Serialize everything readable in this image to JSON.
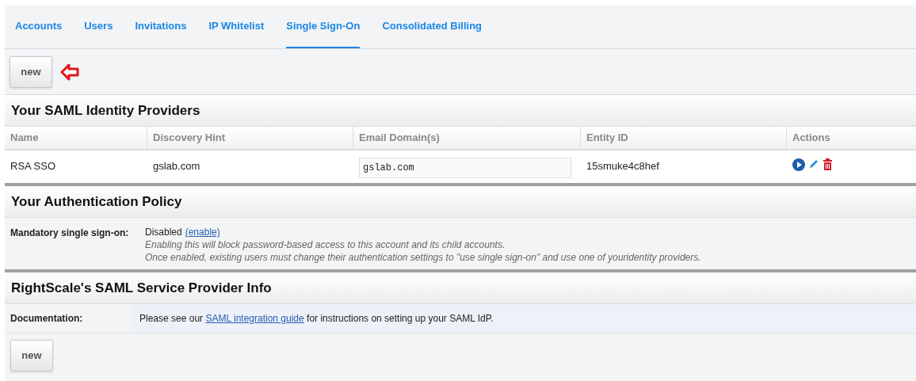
{
  "tabs": [
    {
      "label": "Accounts",
      "selected": false
    },
    {
      "label": "Users",
      "selected": false
    },
    {
      "label": "Invitations",
      "selected": false
    },
    {
      "label": "IP Whitelist",
      "selected": false
    },
    {
      "label": "Single Sign-On",
      "selected": true
    },
    {
      "label": "Consolidated Billing",
      "selected": false
    }
  ],
  "toolbar": {
    "new_button": "new"
  },
  "identity_providers": {
    "title": "Your SAML Identity Providers",
    "columns": [
      "Name",
      "Discovery Hint",
      "Email Domain(s)",
      "Entity ID",
      "Actions"
    ],
    "rows": [
      {
        "name": "RSA SSO",
        "discovery_hint": "gslab.com",
        "email_domains": "gslab.com",
        "entity_id": "15smuke4c8hef"
      }
    ]
  },
  "authentication_policy": {
    "title": "Your Authentication Policy",
    "label": "Mandatory single sign-on:",
    "status": "Disabled",
    "link": "(enable)",
    "notes": [
      "Enabling this will block password-based access to this account and its child accounts.",
      "Once enabled, existing users must change their authentication settings to \"use single sign-on\" and use one of youridentity providers."
    ]
  },
  "service_provider_info": {
    "title": "RightScale's SAML Service Provider Info",
    "label": "Documentation:",
    "text_before": "Please see our",
    "link": "SAML integration guide",
    "text_after": "for instructions on setting up your SAML IdP."
  },
  "bottom_button": "new"
}
